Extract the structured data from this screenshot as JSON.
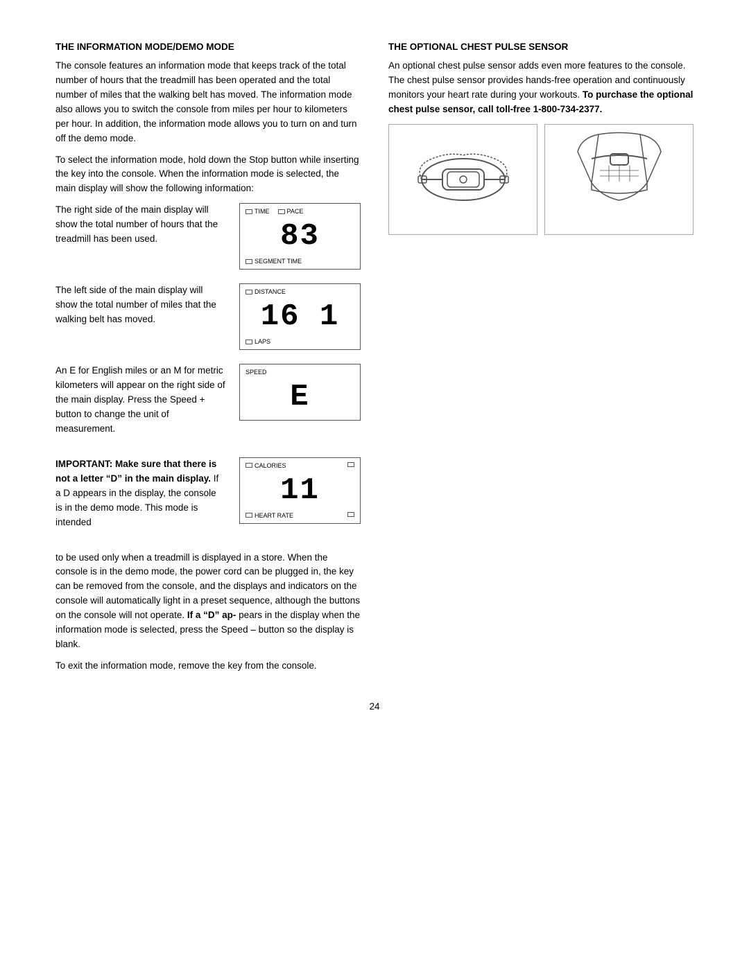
{
  "left_heading": "THE INFORMATION MODE/DEMO MODE",
  "right_heading": "THE OPTIONAL CHEST PULSE SENSOR",
  "left_paragraphs": [
    "The console features an information mode that keeps track of the total number of hours that the treadmill has been operated and the total number of miles that the walking belt has moved. The information mode also allows you to switch the console from miles per hour to kilometers per hour. In addition, the information mode allows you to turn on and turn off the demo mode.",
    "To select the information mode, hold down the Stop button while inserting the key into the console. When the information mode is selected, the main display will show the following information:"
  ],
  "right_paragraph": "An optional chest pulse sensor adds even more features to the console. The chest pulse sensor provides hands-free operation and continuously monitors your heart rate during your workouts.",
  "right_bold": "To purchase the optional chest pulse sensor, call toll-free 1-800-734-2377.",
  "display1": {
    "top_labels": [
      "TIME",
      "PACE"
    ],
    "number": "83",
    "bottom_label": "SEGMENT TIME"
  },
  "display1_text": "The right side of the main display will show the total number of hours that the treadmill has been used.",
  "display2": {
    "top_label": "DISTANCE",
    "number": "16 1",
    "bottom_label": "LAPS"
  },
  "display2_text": "The left side of the main display will show the total number of miles that the walking belt has moved.",
  "display3": {
    "top_label": "SPEED",
    "number": "E"
  },
  "display3_text": "An  E  for English miles or an  M  for metric kilometers will appear on the right side of the main display. Press the Speed + button to change the unit of measurement.",
  "display4": {
    "top_label": "CALORIES",
    "top_right_rect": true,
    "number": "11",
    "bottom_label": "HEART RATE",
    "bottom_right_rect": true
  },
  "important_para": {
    "bold_start": "IMPORTANT: Make sure that there is not a letter “D” in the main display.",
    "normal": " If a D  appears in the display, the console is in the  demo mode. This mode is intended"
  },
  "bottom_paragraphs": [
    "to be used only when a treadmill is displayed in a store. When the console is in the demo mode, the power cord can be plugged in, the key can be removed from the console, and the displays and indicators on the console will automatically light in a preset sequence, although the buttons on the console will not operate.",
    "pears in the display when the information mode is selected, press the Speed – button so the display is blank.",
    "To exit the information mode, remove the key from the console."
  ],
  "bottom_bold_inline": "If a “D” ap-",
  "page_number": "24"
}
